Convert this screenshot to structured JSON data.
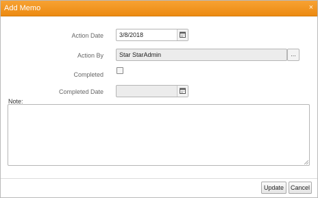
{
  "dialog": {
    "title": "Add Memo",
    "close_symbol": "×"
  },
  "form": {
    "action_date": {
      "label": "Action Date",
      "value": "3/8/2018",
      "icon": "calendar-icon"
    },
    "action_by": {
      "label": "Action By",
      "value": "Star StarAdmin",
      "lookup_button": "..."
    },
    "completed": {
      "label": "Completed",
      "checked": false
    },
    "completed_date": {
      "label": "Completed Date",
      "value": "",
      "icon": "calendar-icon"
    },
    "note": {
      "label": "Note:",
      "value": ""
    }
  },
  "buttons": {
    "update": "Update",
    "cancel": "Cancel"
  },
  "colors": {
    "titlebar": "#ec8a11",
    "title_text": "#ffffff"
  }
}
